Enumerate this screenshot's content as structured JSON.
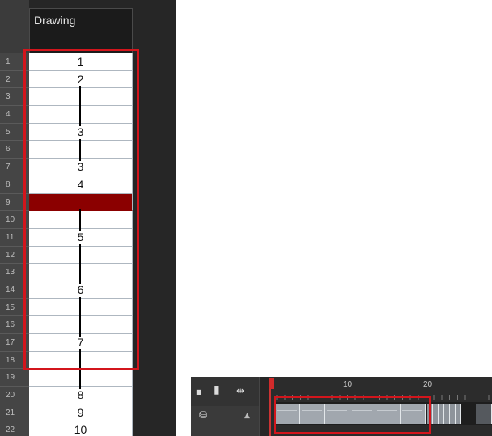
{
  "xsheet": {
    "column_header": "Drawing",
    "rows": [
      {
        "num": "1",
        "drawing": "1",
        "hold": false,
        "selected": false
      },
      {
        "num": "2",
        "drawing": "2",
        "hold": false,
        "selected": false
      },
      {
        "num": "3",
        "drawing": "",
        "hold": true,
        "selected": false
      },
      {
        "num": "4",
        "drawing": "",
        "hold": true,
        "selected": false
      },
      {
        "num": "5",
        "drawing": "3",
        "hold": false,
        "selected": false
      },
      {
        "num": "6",
        "drawing": "",
        "hold": true,
        "selected": false
      },
      {
        "num": "7",
        "drawing": "3",
        "hold": false,
        "selected": false
      },
      {
        "num": "8",
        "drawing": "4",
        "hold": false,
        "selected": false
      },
      {
        "num": "9",
        "drawing": "",
        "hold": false,
        "selected": true
      },
      {
        "num": "10",
        "drawing": "",
        "hold": true,
        "selected": false
      },
      {
        "num": "11",
        "drawing": "5",
        "hold": false,
        "selected": false
      },
      {
        "num": "12",
        "drawing": "",
        "hold": true,
        "selected": false
      },
      {
        "num": "13",
        "drawing": "",
        "hold": true,
        "selected": false
      },
      {
        "num": "14",
        "drawing": "6",
        "hold": false,
        "selected": false
      },
      {
        "num": "15",
        "drawing": "",
        "hold": true,
        "selected": false
      },
      {
        "num": "16",
        "drawing": "",
        "hold": true,
        "selected": false
      },
      {
        "num": "17",
        "drawing": "7",
        "hold": false,
        "selected": false
      },
      {
        "num": "18",
        "drawing": "",
        "hold": true,
        "selected": false
      },
      {
        "num": "19",
        "drawing": "",
        "hold": true,
        "selected": false
      },
      {
        "num": "20",
        "drawing": "8",
        "hold": false,
        "selected": false
      },
      {
        "num": "21",
        "drawing": "9",
        "hold": false,
        "selected": false
      },
      {
        "num": "22",
        "drawing": "10",
        "hold": false,
        "selected": false
      }
    ]
  },
  "timeline": {
    "ruler_labels": [
      "10",
      "20"
    ],
    "icons": {
      "keyframe": "small-square-icon",
      "drawing": "white-rectangle-icon",
      "expand": "expand-arrows-icon",
      "layer": "layer-stack-icon",
      "scroll_up": "scroll-up-arrow-icon"
    }
  },
  "colors": {
    "highlight_box": "#d3151c",
    "selected_cell": "#8b0000",
    "panel_bg": "#262626",
    "frame_block": "#a1a7ae"
  }
}
